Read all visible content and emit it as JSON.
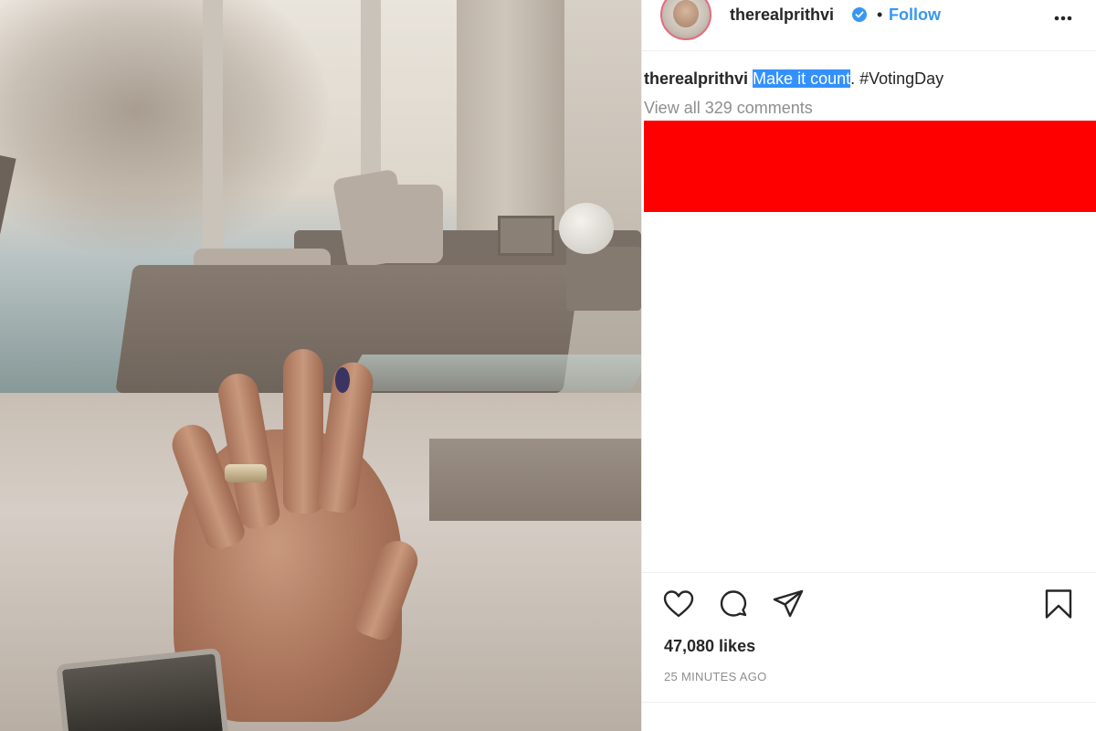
{
  "post": {
    "username": "therealprithvi",
    "verified": true,
    "follow_label": "Follow",
    "dot_separator": "•",
    "caption": {
      "user": "therealprithvi",
      "highlighted_text": "Make it count",
      "rest_text": ". #VotingDay"
    },
    "view_comments": "View all 329 comments",
    "likes": "47,080 likes",
    "timestamp": "25 MINUTES AGO"
  },
  "colors": {
    "accent_blue": "#3897f0",
    "redaction": "#ff0000",
    "text_secondary": "#8e8e8e"
  },
  "icons": [
    "more-icon",
    "heart-icon",
    "comment-icon",
    "share-icon",
    "bookmark-icon",
    "verified-icon"
  ]
}
